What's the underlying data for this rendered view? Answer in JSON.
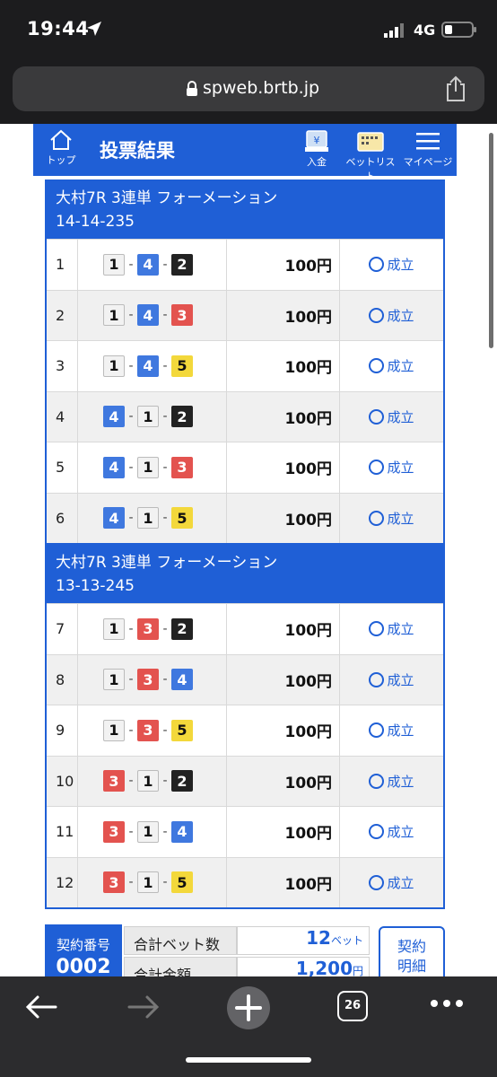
{
  "status_bar": {
    "time": "19:44",
    "network": "4G"
  },
  "browser": {
    "url": "spweb.brtb.jp",
    "tab_count": "26"
  },
  "nav": {
    "home_label": "トップ",
    "title": "投票結果",
    "deposit_label": "入金",
    "betlist_label": "ベットリスト",
    "mypage_label": "マイページ"
  },
  "groups": [
    {
      "title": "大村7R 3連単 フォーメーション",
      "formation": "14-14-235",
      "rows": [
        {
          "no": "1",
          "combo": [
            "1",
            "4",
            "2"
          ],
          "amount": "100円",
          "status": "成立"
        },
        {
          "no": "2",
          "combo": [
            "1",
            "4",
            "3"
          ],
          "amount": "100円",
          "status": "成立"
        },
        {
          "no": "3",
          "combo": [
            "1",
            "4",
            "5"
          ],
          "amount": "100円",
          "status": "成立"
        },
        {
          "no": "4",
          "combo": [
            "4",
            "1",
            "2"
          ],
          "amount": "100円",
          "status": "成立"
        },
        {
          "no": "5",
          "combo": [
            "4",
            "1",
            "3"
          ],
          "amount": "100円",
          "status": "成立"
        },
        {
          "no": "6",
          "combo": [
            "4",
            "1",
            "5"
          ],
          "amount": "100円",
          "status": "成立"
        }
      ]
    },
    {
      "title": "大村7R 3連単 フォーメーション",
      "formation": "13-13-245",
      "rows": [
        {
          "no": "7",
          "combo": [
            "1",
            "3",
            "2"
          ],
          "amount": "100円",
          "status": "成立"
        },
        {
          "no": "8",
          "combo": [
            "1",
            "3",
            "4"
          ],
          "amount": "100円",
          "status": "成立"
        },
        {
          "no": "9",
          "combo": [
            "1",
            "3",
            "5"
          ],
          "amount": "100円",
          "status": "成立"
        },
        {
          "no": "10",
          "combo": [
            "3",
            "1",
            "2"
          ],
          "amount": "100円",
          "status": "成立"
        },
        {
          "no": "11",
          "combo": [
            "3",
            "1",
            "4"
          ],
          "amount": "100円",
          "status": "成立"
        },
        {
          "no": "12",
          "combo": [
            "3",
            "1",
            "5"
          ],
          "amount": "100円",
          "status": "成立"
        }
      ]
    }
  ],
  "summary": {
    "contract_label": "契約番号",
    "contract_no": "0002",
    "total_bets_label": "合計ベット数",
    "total_bets_value": "12",
    "total_bets_unit": "ベット",
    "total_amount_label": "合計金額",
    "total_amount_value": "1,200",
    "total_amount_unit": "円",
    "detail_button": [
      "契約",
      "明細"
    ]
  },
  "colors": {
    "accent": "#1f5fd6",
    "boat_1": "#f2f2f2",
    "boat_2": "#222222",
    "boat_3": "#e3534f",
    "boat_4": "#3f78df",
    "boat_5": "#f3d83b"
  }
}
